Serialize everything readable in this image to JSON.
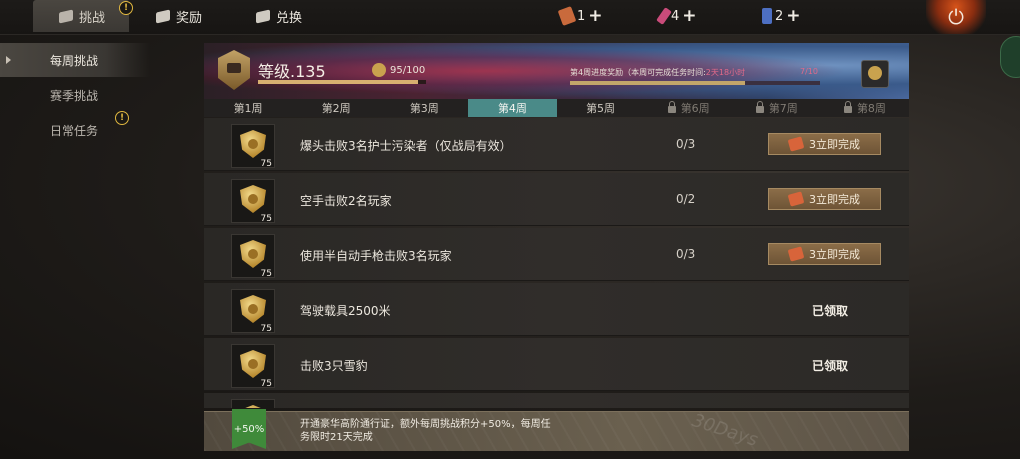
{
  "top_tabs": [
    {
      "label": "挑战",
      "active": true,
      "has_alert": true
    },
    {
      "label": "奖励",
      "active": false,
      "has_alert": false
    },
    {
      "label": "兑换",
      "active": false,
      "has_alert": false
    }
  ],
  "alert_mark": "!",
  "resources": [
    {
      "icon": "ticket-icon",
      "count": "1",
      "color": "#c96a3c"
    },
    {
      "icon": "card-pink-icon",
      "count": "4",
      "color": "#c94b7a"
    },
    {
      "icon": "card-blue-icon",
      "count": "2",
      "color": "#4d6fc2"
    }
  ],
  "plus_symbol": "+",
  "power_symbol": "⏻",
  "sidebar": [
    {
      "label": "每周挑战",
      "active": true,
      "has_alert": false
    },
    {
      "label": "赛季挑战",
      "active": false,
      "has_alert": false
    },
    {
      "label": "日常任务",
      "active": false,
      "has_alert": true
    }
  ],
  "banner": {
    "level_text": "等级.135",
    "points": "95/100",
    "points_progress": 0.95,
    "week_reward_label": "第4周进度奖励（本周可完成任务时间:",
    "week_reward_time": "2天18小时",
    "week_reward_count": "7/10",
    "week_progress": 0.7
  },
  "week_tabs": [
    {
      "label": "第1周",
      "active": false,
      "locked": false
    },
    {
      "label": "第2周",
      "active": false,
      "locked": false
    },
    {
      "label": "第3周",
      "active": false,
      "locked": false
    },
    {
      "label": "第4周",
      "active": true,
      "locked": false
    },
    {
      "label": "第5周",
      "active": false,
      "locked": false
    },
    {
      "label": "第6周",
      "active": false,
      "locked": true
    },
    {
      "label": "第7周",
      "active": false,
      "locked": true
    },
    {
      "label": "第8周",
      "active": false,
      "locked": true
    }
  ],
  "tasks": [
    {
      "reward_qty": "75",
      "text": "爆头击败3名护士污染者（仅战局有效）",
      "progress": "0/3",
      "status": "button",
      "button_label": "3立即完成"
    },
    {
      "reward_qty": "75",
      "text": "空手击败2名玩家",
      "progress": "0/2",
      "status": "button",
      "button_label": "3立即完成"
    },
    {
      "reward_qty": "75",
      "text": "使用半自动手枪击败3名玩家",
      "progress": "0/3",
      "status": "button",
      "button_label": "3立即完成"
    },
    {
      "reward_qty": "75",
      "text": "驾驶载具2500米",
      "progress": "",
      "status": "claimed",
      "claimed_label": "已领取"
    },
    {
      "reward_qty": "75",
      "text": "击败3只雪豹",
      "progress": "",
      "status": "claimed",
      "claimed_label": "已领取"
    }
  ],
  "promo": {
    "badge": "+50%",
    "text": "开通豪华高阶通行证，额外每周挑战积分+50%，每周任务限时21天完成",
    "watermark": "30Days"
  }
}
